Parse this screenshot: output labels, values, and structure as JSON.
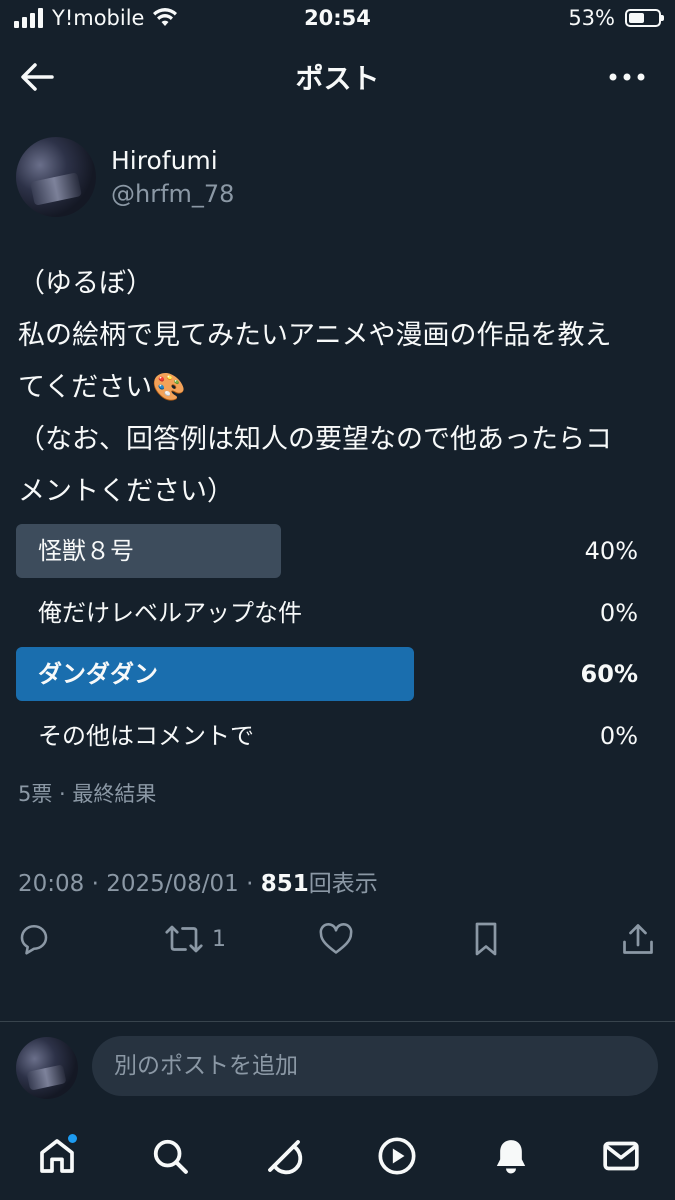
{
  "status_bar": {
    "carrier": "Y!mobile",
    "time": "20:54",
    "battery_percent": "53%",
    "battery_level": 0.53
  },
  "header": {
    "title": "ポスト",
    "back_icon": "back-arrow-icon",
    "more_icon": "more-horizontal-icon"
  },
  "author": {
    "name": "Hirofumi",
    "handle": "@hrfm_78"
  },
  "post": {
    "lines": [
      "（ゆるぼ）",
      "私の絵柄で見てみたいアニメや漫画の作品を教え",
      "てください🎨",
      "（なお、回答例は知人の要望なので他あったらコ",
      "メントください）"
    ]
  },
  "poll": {
    "options": [
      {
        "label": "怪獣８号",
        "percent_text": "40%",
        "fraction": 0.4,
        "winner": false
      },
      {
        "label": "俺だけレベルアップな件",
        "percent_text": "0%",
        "fraction": 0.0,
        "winner": false
      },
      {
        "label": "ダンダダン",
        "percent_text": "60%",
        "fraction": 0.6,
        "winner": true
      },
      {
        "label": "その他はコメントで",
        "percent_text": "0%",
        "fraction": 0.0,
        "winner": false
      }
    ],
    "meta": "5票 · 最終結果"
  },
  "timestamp": {
    "time": "20:08",
    "separator": "·",
    "date": "2025/08/01",
    "views": "851",
    "views_label": "回表示"
  },
  "actions": {
    "reply_icon": "reply-icon",
    "retweet_icon": "retweet-icon",
    "retweet_count": "1",
    "like_icon": "heart-icon",
    "bookmark_icon": "bookmark-icon",
    "share_icon": "share-icon"
  },
  "reply": {
    "placeholder": "別のポストを追加"
  },
  "navbar": {
    "items": [
      "home-icon",
      "search-icon",
      "grok-icon",
      "video-icon",
      "notifications-icon",
      "messages-icon"
    ]
  },
  "colors": {
    "background": "#15202b",
    "winner_bar": "#1a6eae",
    "option_bar": "#3d4c5c",
    "accent": "#1d9bf0"
  }
}
